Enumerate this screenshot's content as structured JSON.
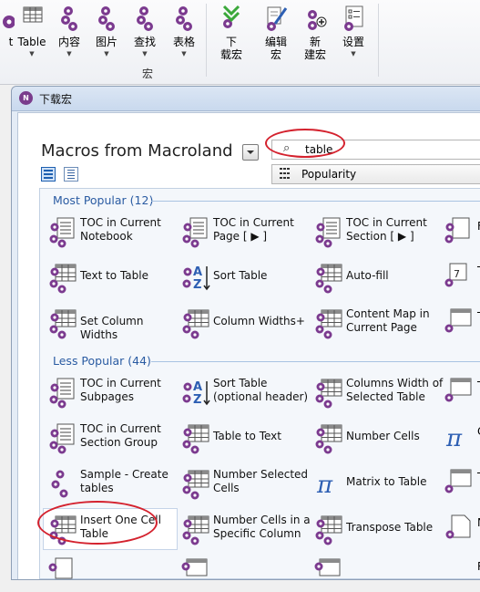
{
  "ribbon": {
    "buttons": [
      {
        "label": "t",
        "icon": "partial-gear-icon"
      },
      {
        "label": "Table",
        "icon": "table-grid-icon"
      },
      {
        "label": "内容",
        "icon": "gear-cluster-icon"
      },
      {
        "label": "图片",
        "icon": "gear-cluster-icon"
      },
      {
        "label": "查找",
        "icon": "gear-cluster-icon"
      },
      {
        "label": "表格",
        "icon": "gear-cluster-icon"
      },
      {
        "label": "下\n载宏",
        "icon": "download-macro-icon"
      },
      {
        "label": "编辑\n宏",
        "icon": "edit-macro-icon"
      },
      {
        "label": "新\n建宏",
        "icon": "new-macro-icon"
      },
      {
        "label": "设置",
        "icon": "settings-icon"
      }
    ],
    "group_label": "宏"
  },
  "dialog": {
    "title": "下载宏",
    "macros_title": "Macros from Macroland",
    "search_value": "table",
    "sort_value": "Popularity",
    "sections": [
      {
        "label": "Most Popular (12)",
        "items": [
          {
            "text": "TOC in Current Notebook",
            "icon": "toc-gear-icon"
          },
          {
            "text": "TOC in Current Page [ ▶ ]",
            "icon": "toc-gear-icon"
          },
          {
            "text": "TOC in Current Section [ ▶ ]",
            "icon": "toc-gear-icon"
          },
          {
            "text": "Text to Table",
            "icon": "table-gear-icon"
          },
          {
            "text": "Sort Table",
            "icon": "sort-az-icon"
          },
          {
            "text": "Auto-fill",
            "icon": "table-gear-icon"
          },
          {
            "text": "Set Column Widths",
            "icon": "table-gear-icon"
          },
          {
            "text": "Column Widths+",
            "icon": "table-gear-icon"
          },
          {
            "text": "Content Map in Current Page",
            "icon": "table-gear-icon"
          }
        ]
      },
      {
        "label": "Less Popular (44)",
        "items": [
          {
            "text": "TOC in Current Subpages",
            "icon": "toc-gear-icon"
          },
          {
            "text": "Sort Table (optional header)",
            "icon": "sort-az-icon"
          },
          {
            "text": "Columns Width of Selected Table",
            "icon": "table-gear-icon"
          },
          {
            "text": "TOC in Current Section Group",
            "icon": "toc-gear-icon"
          },
          {
            "text": "Table to Text",
            "icon": "table-gear-icon"
          },
          {
            "text": "Number Cells",
            "icon": "table-gear-icon"
          },
          {
            "text": "Sample - Create tables",
            "icon": "gear-cluster-icon"
          },
          {
            "text": "Number Selected Cells",
            "icon": "table-gear-icon"
          },
          {
            "text": "Matrix to Table",
            "icon": "pi-icon"
          },
          {
            "text": "Insert One Cell Table",
            "icon": "table-gear-icon"
          },
          {
            "text": "Number Cells in a Specific Column",
            "icon": "table-gear-icon"
          },
          {
            "text": "Transpose Table",
            "icon": "table-gear-icon"
          }
        ]
      }
    ],
    "partial_right_labels": [
      "F",
      "T",
      "T",
      "T",
      "C",
      "T",
      "N",
      "R"
    ]
  }
}
